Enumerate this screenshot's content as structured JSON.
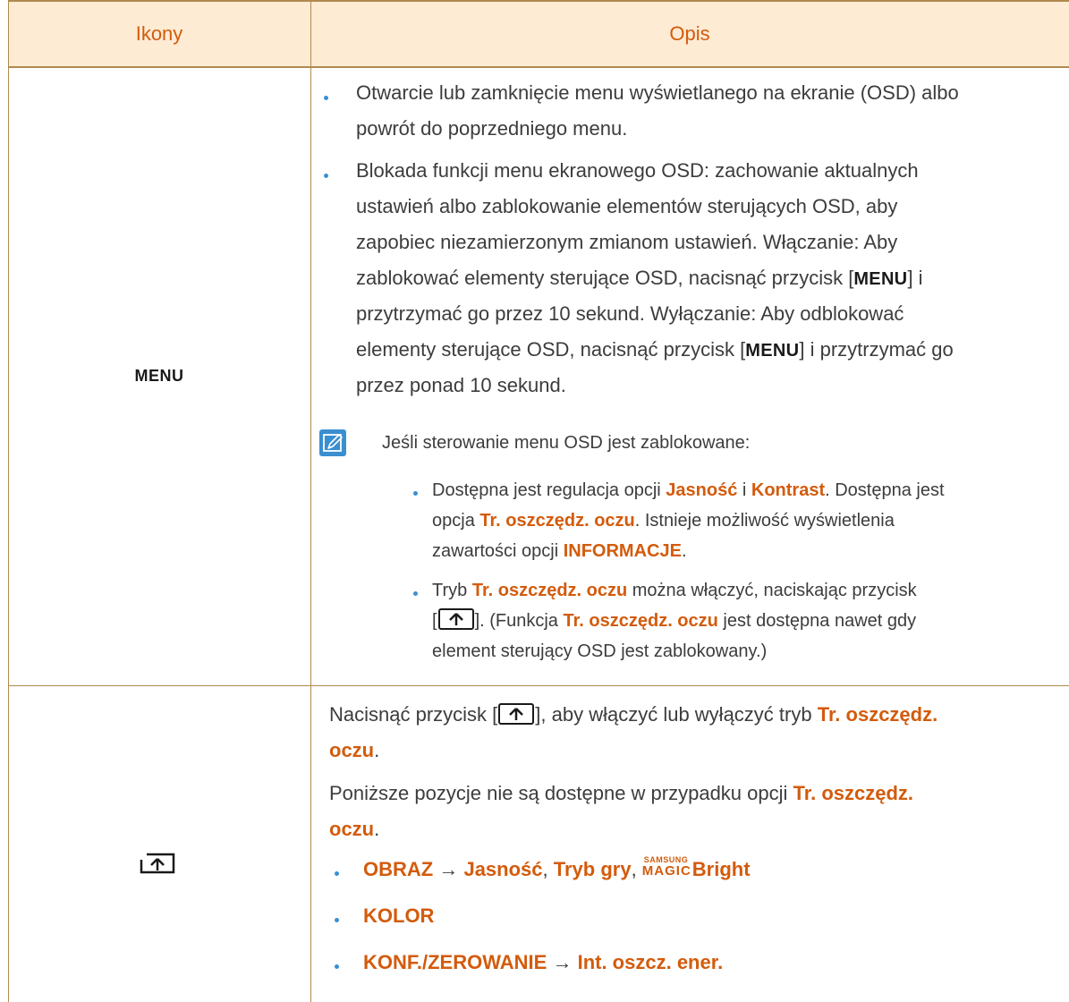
{
  "header": {
    "icons": "Ikony",
    "description": "Opis"
  },
  "row1": {
    "icon_label": "MENU",
    "bullet1": {
      "l1": "Otwarcie lub zamknięcie menu wyświetlanego na ekranie (OSD) albo",
      "l2": "powrót do poprzedniego menu."
    },
    "bullet2": {
      "l1": "Blokada funkcji menu ekranowego OSD: zachowanie aktualnych",
      "l2": "ustawień albo zablokowanie elementów sterujących OSD, aby",
      "l3": "zapobiec niezamierzonym zmianom ustawień. Włączanie: Aby",
      "l4_a": "zablokować elementy sterujące OSD, nacisnąć przycisk [",
      "l4_b": "] i",
      "l5": "przytrzymać go przez 10 sekund. Wyłączanie: Aby odblokować",
      "l6_a": "elementy sterujące OSD, nacisnąć przycisk [",
      "l6_b": "] i przytrzymać go",
      "l7": "przez ponad 10 sekund.",
      "menu_key": "MENU"
    },
    "note": {
      "intro": "Jeśli sterowanie menu OSD jest zablokowane:",
      "s1": {
        "l1_a": "Dostępna jest regulacja opcji ",
        "jasnosc": "Jasność",
        "l1_b": " i ",
        "kontrast": "Kontrast",
        "l1_c": ". Dostępna jest",
        "l2_a": "opcja ",
        "eye": "Tr. oszczędz. oczu",
        "l2_b": ". Istnieje możliwość wyświetlenia",
        "l3_a": "zawartości opcji ",
        "info": "INFORMACJE",
        "l3_b": "."
      },
      "s2": {
        "l1_a": "Tryb ",
        "eye": "Tr. oszczędz. oczu",
        "l1_b": " można włączyć, naciskając przycisk",
        "l2_a": "[",
        "l2_b": "]. (Funkcja ",
        "l2_c": " jest dostępna nawet gdy",
        "l3": "element sterujący OSD jest zablokowany.)"
      }
    }
  },
  "row2": {
    "p1": {
      "a": "Nacisnąć przycisk [",
      "b": "], aby włączyć lub wyłączyć tryb ",
      "eye1": "Tr. oszczędz.",
      "eye2": "oczu",
      "c": "."
    },
    "p2": {
      "a": "Poniższe pozycje nie są dostępne w przypadku opcji ",
      "eye1": "Tr. oszczędz.",
      "eye2": "oczu",
      "c": "."
    },
    "items": {
      "i1": {
        "obraz": "OBRAZ",
        "arrow": " → ",
        "jasnosc": "Jasność",
        "sep": ", ",
        "tryb": "Tryb gry",
        "samsung": "SAMSUNG",
        "magic": "MAGIC",
        "bright": "Bright"
      },
      "i2": {
        "kolor": "KOLOR"
      },
      "i3": {
        "konf": "KONF./ZEROWANIE",
        "arrow": " → ",
        "int": "Int. oszcz. ener."
      }
    }
  },
  "colors": {
    "accent": "#d35b0c",
    "header_bg": "#fdebd4",
    "rule": "#b08a4e",
    "bullet": "#3a8fd0"
  }
}
